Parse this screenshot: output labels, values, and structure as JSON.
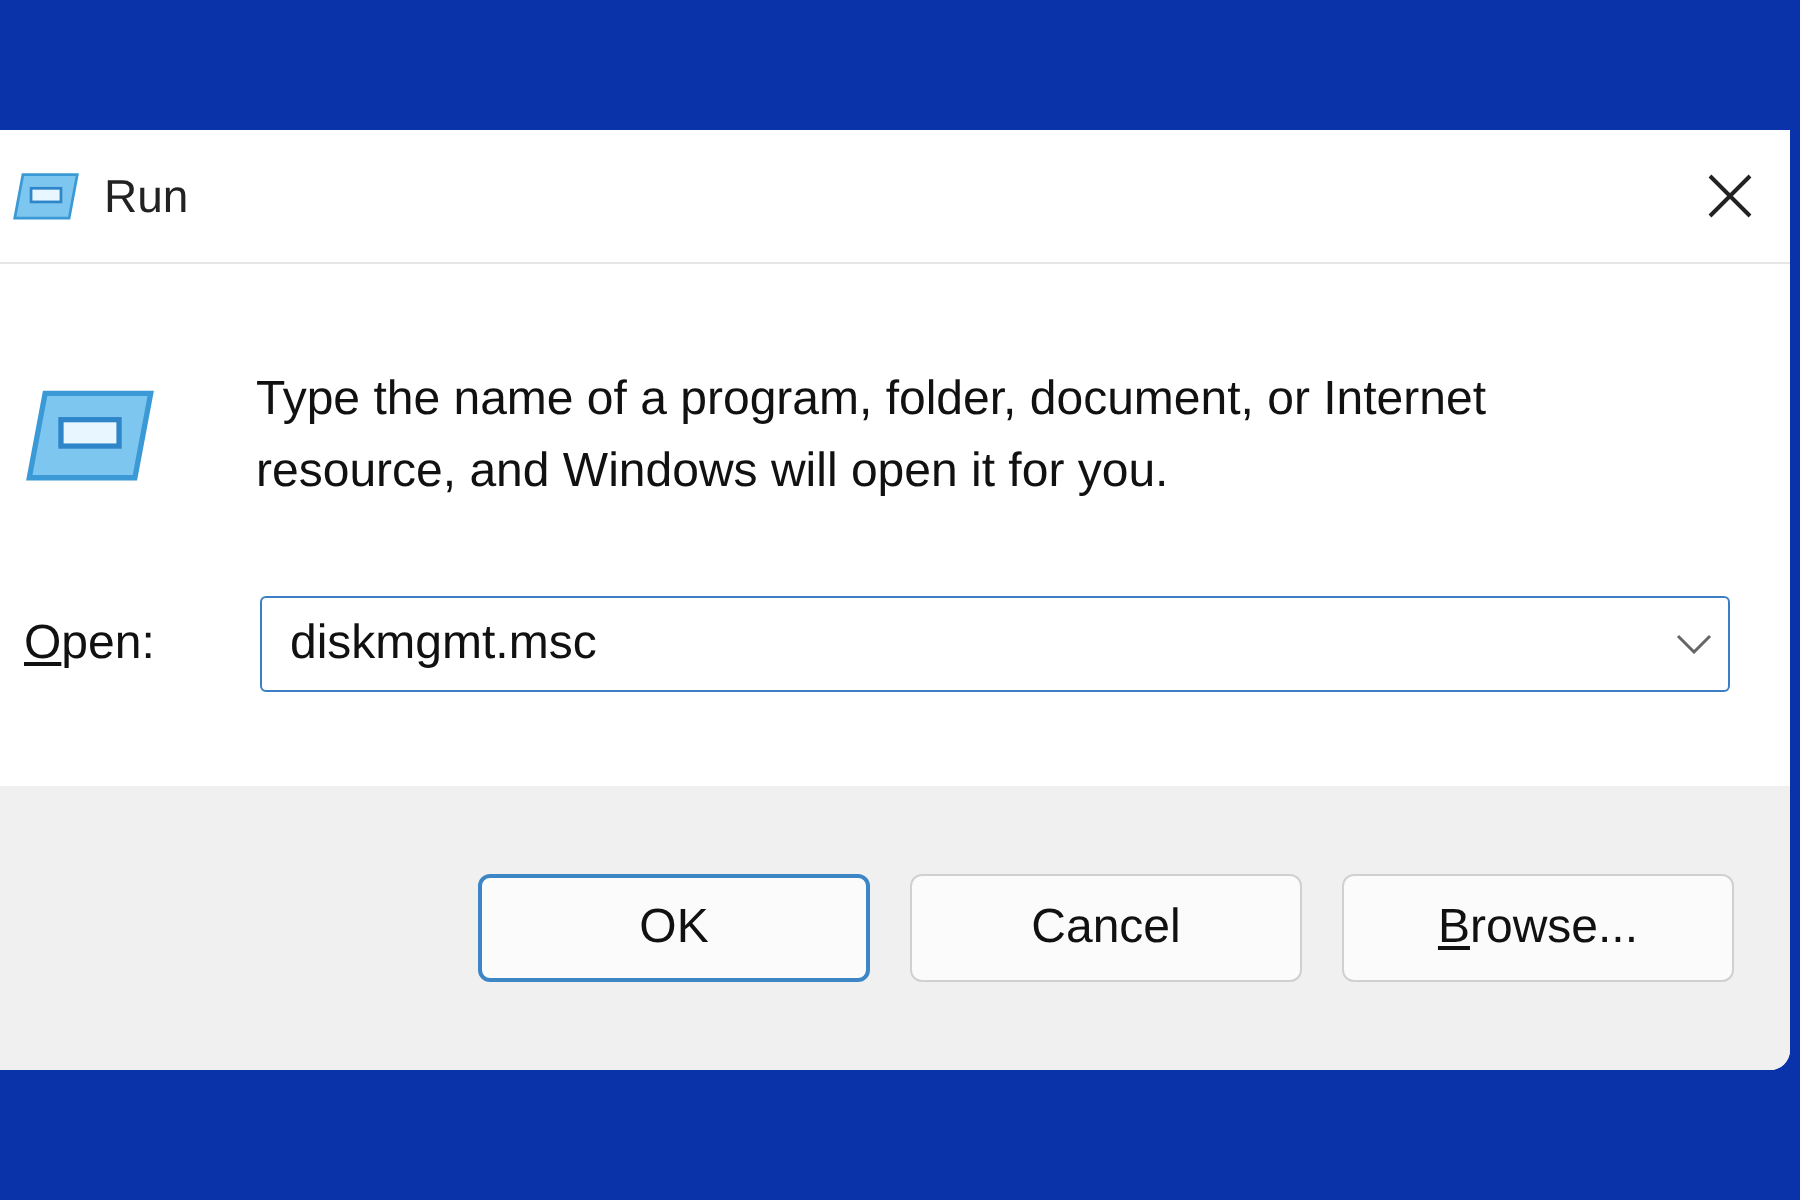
{
  "window": {
    "title": "Run"
  },
  "message": "Type the name of a program, folder, document, or Internet resource, and Windows will open it for you.",
  "open_field": {
    "label": "Open:",
    "access_key_underlined": true,
    "value": "diskmgmt.msc",
    "focused": true
  },
  "buttons": [
    {
      "label": "OK",
      "default": true,
      "access_key_underlined": false
    },
    {
      "label": "Cancel",
      "default": false,
      "access_key_underlined": false
    },
    {
      "label": "Browse...",
      "default": false,
      "access_key_underlined": true
    }
  ]
}
